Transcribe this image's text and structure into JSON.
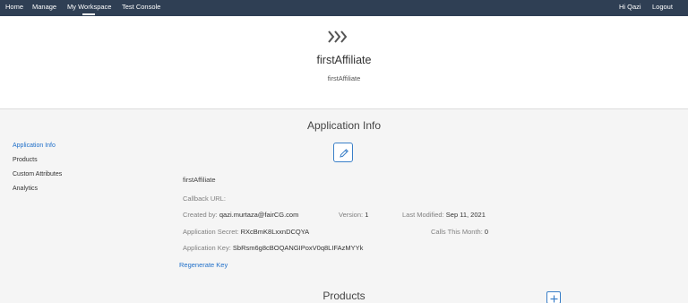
{
  "nav": {
    "home": "Home",
    "manage": "Manage",
    "my_workspace": "My Workspace",
    "test_console": "Test Console",
    "greeting": "Hi Qazi",
    "logout": "Logout"
  },
  "hero": {
    "icon": "triple-chevron-right-icon",
    "title": "firstAffiliate",
    "subtitle": "firstAffiliate"
  },
  "sidebar": {
    "items": [
      {
        "label": "Application Info",
        "active": true
      },
      {
        "label": "Products",
        "active": false
      },
      {
        "label": "Custom Attributes",
        "active": false
      },
      {
        "label": "Analytics",
        "active": false
      }
    ]
  },
  "app_info": {
    "heading": "Application Info",
    "edit_icon": "pencil-icon",
    "name": "firstAffiliate",
    "callback_label": "Callback URL:",
    "callback_value": "",
    "created_by_label": "Created by:",
    "created_by_value": "qazi.murtaza@fairCG.com",
    "version_label": "Version:",
    "version_value": "1",
    "last_modified_label": "Last Modified:",
    "last_modified_value": "Sep 11, 2021",
    "secret_label": "Application Secret:",
    "secret_value": "RXcBmK8LxxnDCQYA",
    "calls_label": "Calls This Month:",
    "calls_value": "0",
    "key_label": "Application Key:",
    "key_value": "SbRsm6g8cBOQANGIPoxV0q8LIFAzMYYk",
    "regenerate_label": "Regenerate Key"
  },
  "products": {
    "heading": "Products",
    "add_icon": "plus-icon"
  },
  "colors": {
    "nav_bg": "#2f3f54",
    "accent": "#1f6fc9",
    "page_bg": "#f5f5f5"
  }
}
